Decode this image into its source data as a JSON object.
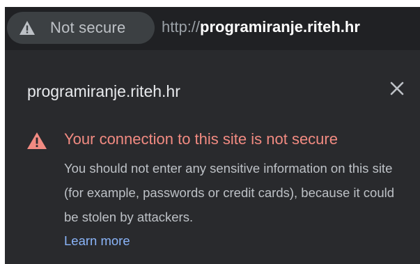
{
  "omnibox": {
    "security_chip_label": "Not secure",
    "url_scheme": "http://",
    "url_host": "programiranje.riteh.hr",
    "chip_icon": "warning-triangle-icon"
  },
  "popup": {
    "site_title": "programiranje.riteh.hr",
    "close_icon": "close-icon",
    "warning_icon": "warning-triangle-icon",
    "warning_title": "Your connection to this site is not secure",
    "warning_body": "You should not enter any sensitive information on this site (for example, passwords or credit cards), because it could be stolen by attackers.",
    "learn_more_label": "Learn more"
  },
  "colors": {
    "background": "#202124",
    "popup_background": "#292a2d",
    "warning_red": "#f28b82",
    "link_blue": "#8ab4f8"
  }
}
